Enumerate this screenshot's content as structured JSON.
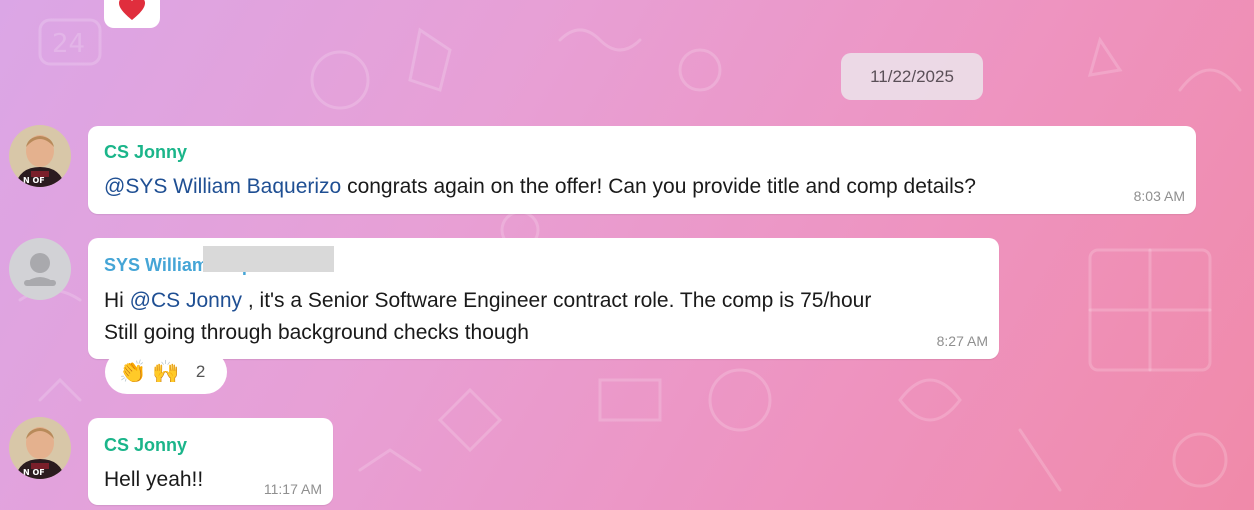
{
  "date_separator": "11/22/2025",
  "messages": [
    {
      "sender": "CS Jonny",
      "mention": "@SYS William Baquerizo",
      "text": " congrats again on the offer! Can you provide title and comp details?",
      "time": "8:03 AM"
    },
    {
      "sender": "SYS William Baquerizo",
      "line1_prefix": "Hi ",
      "mention": "@CS Jonny",
      "line1_suffix": " , it's a Senior Software Engineer contract role. The comp is 75/hour",
      "line2": "Still going through background checks though",
      "time": "8:27 AM",
      "reactions": {
        "emojis": [
          "👏",
          "🙌"
        ],
        "count": "2"
      }
    },
    {
      "sender": "CS Jonny",
      "text": "Hell yeah!!",
      "time": "11:17 AM"
    }
  ],
  "colors": {
    "jonny_name": "#1bb58a",
    "william_name": "#45a5d6",
    "mention": "#1f4f93",
    "heart": "#e02e3d"
  },
  "icons": [
    "heart-icon",
    "default-user-icon"
  ]
}
